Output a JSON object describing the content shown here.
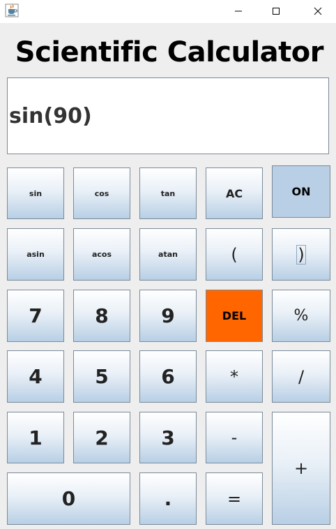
{
  "window": {
    "icon": "java-cup-icon",
    "controls": [
      "minimize-icon",
      "maximize-icon",
      "close-icon"
    ]
  },
  "heading": "Scientific Calculator",
  "display": {
    "expression": "sin(90)"
  },
  "colors": {
    "key_gradient_top": "#ffffff",
    "key_gradient_bottom": "#b8cfe5",
    "del_key": "#ff6600",
    "on_key": "#b8cfe5"
  },
  "keys": {
    "sin": "sin",
    "cos": "cos",
    "tan": "tan",
    "ac": "AC",
    "on": "ON",
    "asin": "asin",
    "acos": "acos",
    "atan": "atan",
    "open_paren": "(",
    "close_paren": ")",
    "seven": "7",
    "eight": "8",
    "nine": "9",
    "del": "DEL",
    "percent": "%",
    "four": "4",
    "five": "5",
    "six": "6",
    "multiply": "*",
    "divide": "/",
    "one": "1",
    "two": "2",
    "three": "3",
    "minus": "-",
    "plus": "+",
    "zero": "0",
    "dot": ".",
    "equals": "="
  }
}
